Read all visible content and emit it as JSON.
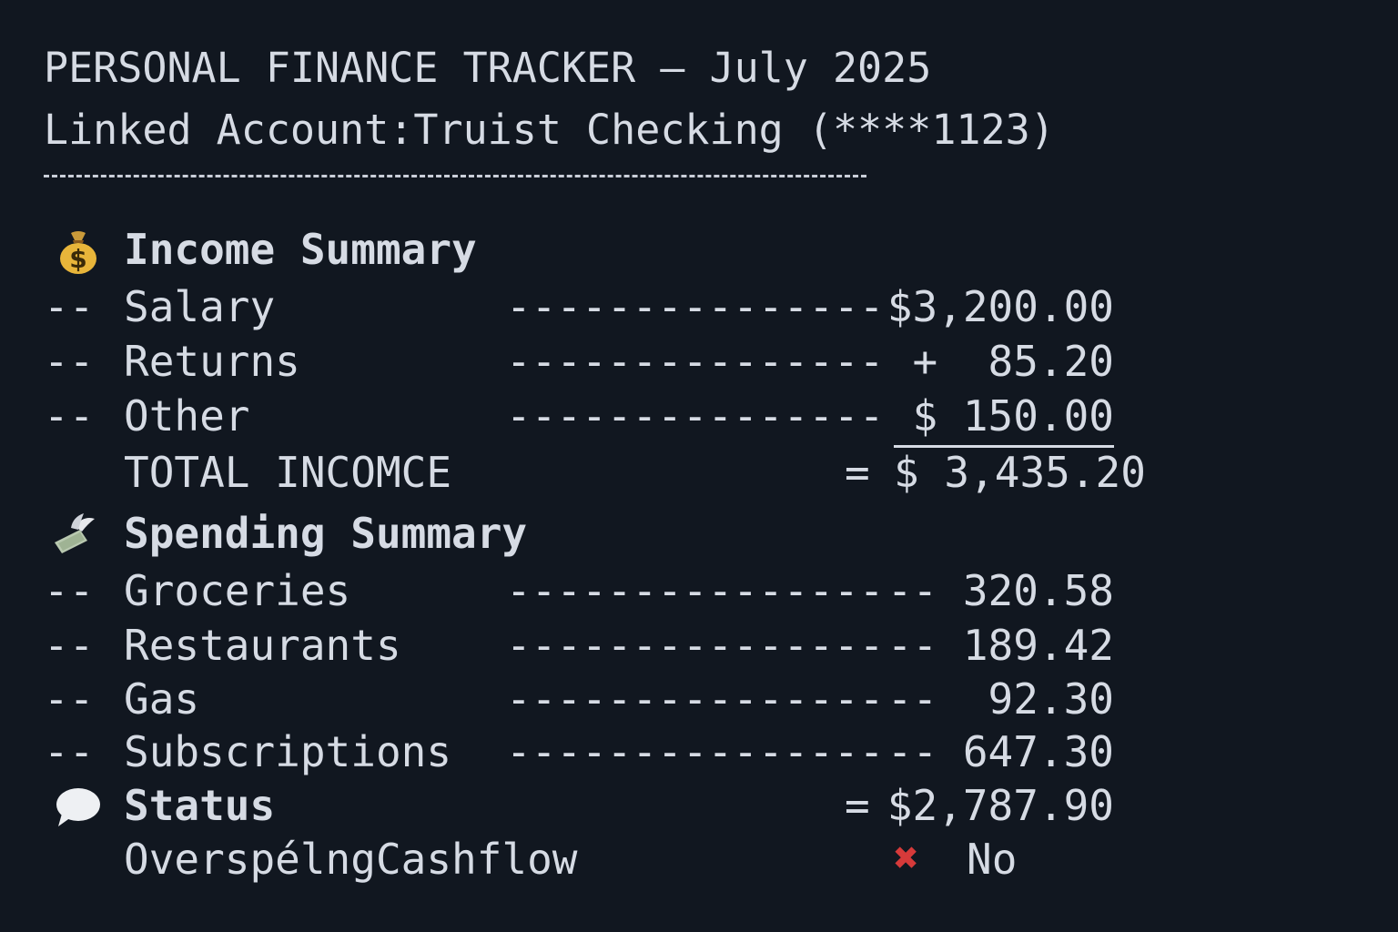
{
  "header": {
    "title": "PERSONAL FINANCE TRACKER — July 2025",
    "linked_account_label": "Linked Account:",
    "linked_account_value": "Truist Checking (****1123)",
    "separator": "----------------------------------"
  },
  "income": {
    "icon": "money-bag-icon",
    "heading": "Income Summary",
    "items": [
      {
        "prefix": "--",
        "label": "Salary",
        "leader": "---------------",
        "amount": "$3,200.00"
      },
      {
        "prefix": "--",
        "label": "Returns",
        "leader": "---------------",
        "amount": "+  85.20"
      },
      {
        "prefix": "--",
        "label": "Other",
        "leader": "---------------",
        "amount": "$ 150.00"
      }
    ],
    "total_label": "TOTAL INCOMCE",
    "total_equals": "=",
    "total_amount": "$ 3,435.20"
  },
  "spending": {
    "icon": "money-with-wings-icon",
    "heading": "Spending Summary",
    "items": [
      {
        "prefix": "--",
        "label": "Groceries",
        "leader": "---------------",
        "amount": "-- 320.58"
      },
      {
        "prefix": "--",
        "label": "Restaurants",
        "leader": "---------------",
        "amount": "-- 189.42"
      },
      {
        "prefix": "--",
        "label": "Gas",
        "leader": "---------------",
        "amount": "--  92.30"
      },
      {
        "prefix": "--",
        "label": "Subscriptions",
        "leader": "---------------",
        "amount": "-- 647.30"
      }
    ]
  },
  "status": {
    "icon": "speech-bubble-icon",
    "heading": "Status",
    "equals": "=",
    "amount": "$2,787.90",
    "flag_label": "OverspélngCashflow",
    "flag_icon": "cross-mark-icon",
    "flag_symbol": "✖",
    "flag_value": "No"
  },
  "colors": {
    "background": "#111720",
    "text": "#d6dbe4",
    "cross": "#d63a3a",
    "coin": "#e8b53a"
  }
}
